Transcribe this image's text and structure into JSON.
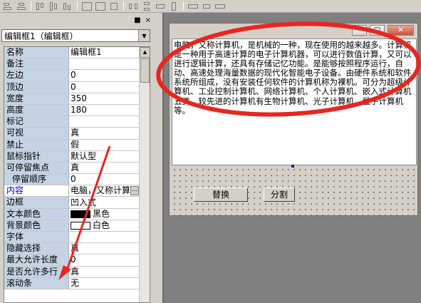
{
  "panel": {
    "pin_label": "■",
    "close_label": "×",
    "selector_value": "编辑框1（编辑框）"
  },
  "properties": [
    {
      "name": "名称",
      "value": "编辑框1"
    },
    {
      "name": "备注",
      "value": ""
    },
    {
      "name": "左边",
      "value": "0"
    },
    {
      "name": "顶边",
      "value": "0"
    },
    {
      "name": "宽度",
      "value": "350"
    },
    {
      "name": "高度",
      "value": "180"
    },
    {
      "name": "标记",
      "value": ""
    },
    {
      "name": "可视",
      "value": "真"
    },
    {
      "name": "禁止",
      "value": "假"
    },
    {
      "name": "鼠标指针",
      "value": "默认型"
    },
    {
      "name": "可停留焦点",
      "value": "真"
    },
    {
      "name": "停留顺序",
      "value": "0"
    },
    {
      "name": "内容",
      "value": "电脑，又称计算"
    },
    {
      "name": "边框",
      "value": "凹入式"
    },
    {
      "name": "文本颜色",
      "value": "黑色"
    },
    {
      "name": "背景颜色",
      "value": "白色"
    },
    {
      "name": "字体",
      "value": ""
    },
    {
      "name": "隐藏选择",
      "value": "真"
    },
    {
      "name": "最大允许长度",
      "value": "0"
    },
    {
      "name": "是否允许多行",
      "value": "真"
    },
    {
      "name": "滚动条",
      "value": "无"
    }
  ],
  "content_button_label": "...",
  "colors": {
    "text_color_swatch": "#000000",
    "background_color_swatch": "#ffffff",
    "name_column_bg": "#c5d4e5",
    "annotation_red": "#e8251f"
  },
  "form": {
    "minimize_label": "–",
    "maximize_label": "□",
    "close_label": "✕",
    "edit_text": "电脑，又称计算机，是机械的一种，现在使用的越来越多。计算机是一种用于高速计算的电子计算机器，可以进行数值计算，又可以进行逻辑计算，还具有存储记忆功能。是能够按照程序运行，自动、高速处理海量数据的现代化智能电子设备。由硬件系统和软件系统所组成，没有安装任何软件的计算机称为裸机。可分为超级计算机、工业控制计算机、网络计算机、个人计算机、嵌入式计算机五类，较先进的计算机有生物计算机、光子计算机、量子计算机等。",
    "replace_button": "替换",
    "split_button": "分割"
  }
}
